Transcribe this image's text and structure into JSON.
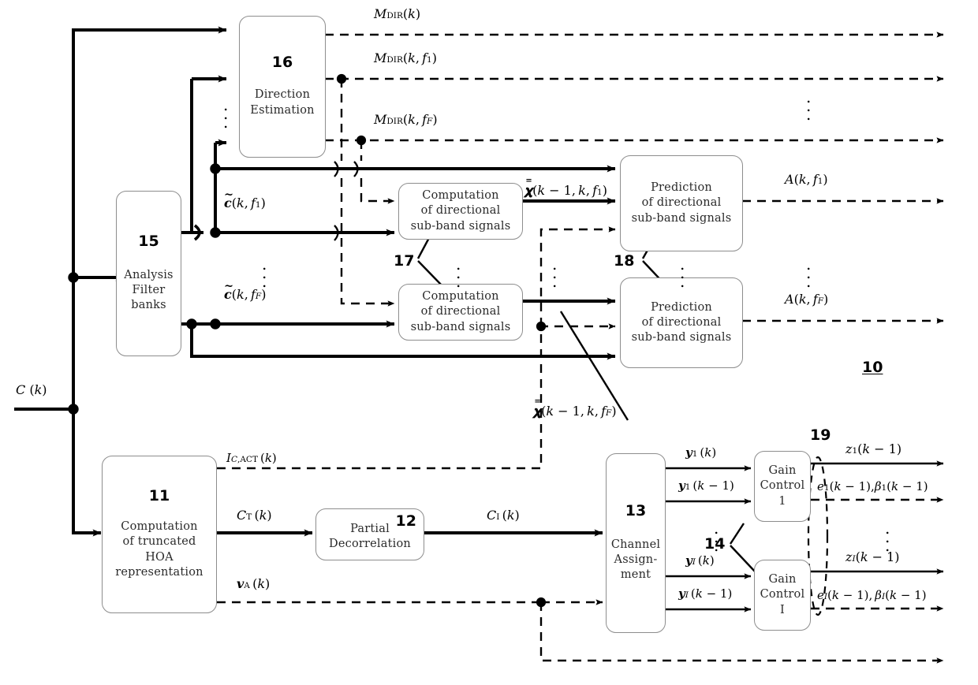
{
  "figure": {
    "ref": "10"
  },
  "blocks": [
    {
      "id": "b15",
      "num": "15",
      "lines": [
        "Analysis",
        "Filter",
        "banks"
      ]
    },
    {
      "id": "b16",
      "num": "16",
      "lines": [
        "Direction",
        "Estimation"
      ]
    },
    {
      "id": "b17a",
      "num": "17",
      "lines": [
        "Computation",
        "of directional",
        "sub-band signals"
      ]
    },
    {
      "id": "b17b",
      "num": "17",
      "lines": [
        "Computation",
        "of directional",
        "sub-band signals"
      ]
    },
    {
      "id": "b18a",
      "num": "18",
      "lines": [
        "Prediction",
        "of directional",
        "sub-band signals"
      ]
    },
    {
      "id": "b18b",
      "num": "18",
      "lines": [
        "Prediction",
        "of directional",
        "sub-band signals"
      ]
    },
    {
      "id": "b11",
      "num": "11",
      "lines": [
        "Computation",
        "of truncated",
        "HOA",
        "representation"
      ]
    },
    {
      "id": "b12",
      "num": "12",
      "lines": [
        "Partial",
        "Decorrelation"
      ]
    },
    {
      "id": "b13",
      "num": "13",
      "lines": [
        "Channel",
        "Assign-",
        "ment"
      ]
    },
    {
      "id": "b14a",
      "num": "14",
      "lines": [
        "Gain",
        "Control",
        "1"
      ]
    },
    {
      "id": "b14b",
      "num": "14",
      "lines": [
        "Gain",
        "Control",
        "I"
      ]
    }
  ],
  "refnums": {
    "n17": "17",
    "n18": "18",
    "n14": "14",
    "n19": "19"
  },
  "signals": {
    "input_c": "C (k)",
    "mdir_k": "M_DIR(k)",
    "mdir_kf1": "M_DIR(k, f_1)",
    "mdir_kfF": "M_DIR(k, f_F)",
    "ctilde_f1": "c~(k, f_1)",
    "ctilde_fF": "c~(k, f_F)",
    "xbar_f1": "X=(k - 1, k, f_1)",
    "xbar_fF": "X=(k - 1, k, f_F)",
    "a_kf1": "A(k, f_1)",
    "a_kfF": "A(k, f_F)",
    "i_cact": "I_C,ACT (k)",
    "c_t": "C_T (k)",
    "v_a": "v_A (k)",
    "c_i": "C_I (k)",
    "y1_k": "y_1 (k)",
    "y1_km1": "y_1 (k - 1)",
    "yI_k": "y_I (k)",
    "yI_km1": "y_I (k - 1)",
    "z1": "z_1(k - 1)",
    "zI": "z_I(k - 1)",
    "e1b1": "e_1(k - 1), beta_1(k - 1)",
    "eIbI": "e_I(k - 1), beta_I(k - 1)"
  },
  "colors": {
    "line": "#000000",
    "box_border": "#8d8d8d",
    "text": "#2a2a2a",
    "background": "#ffffff"
  }
}
